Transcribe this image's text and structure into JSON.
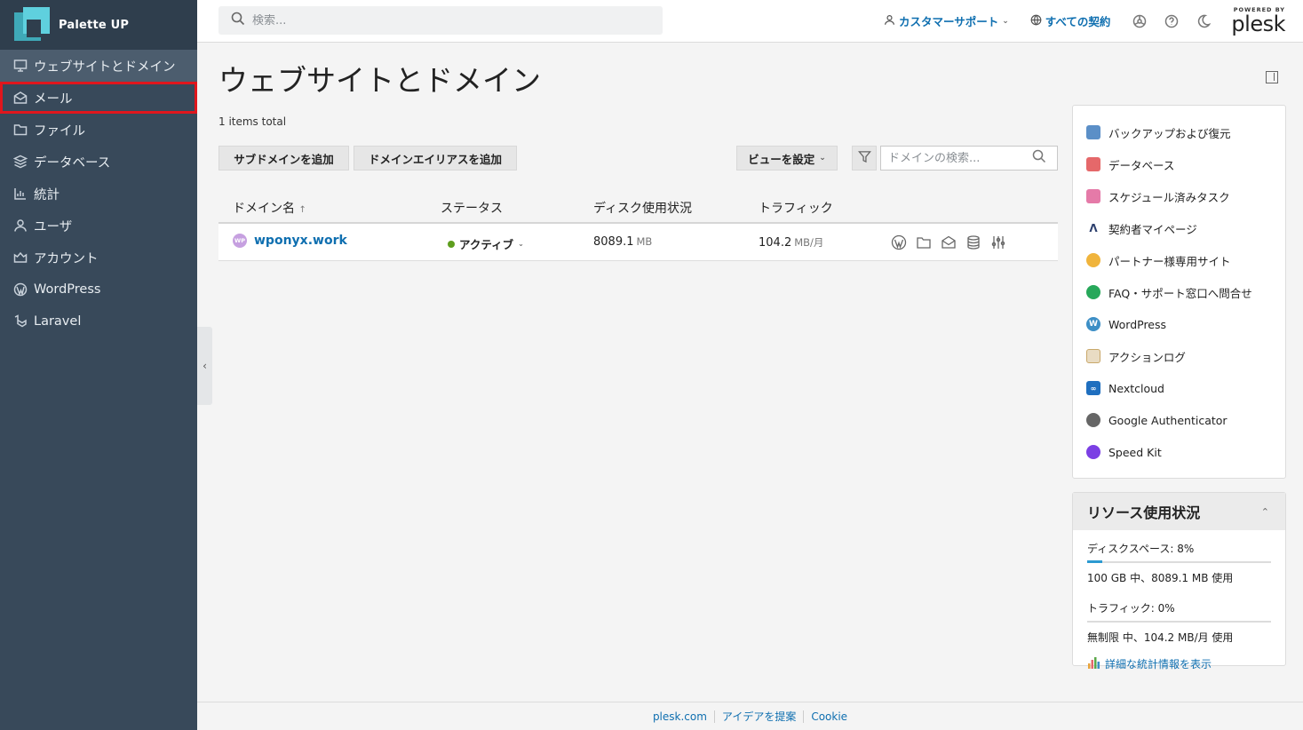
{
  "brand": {
    "name": "Palette UP"
  },
  "sidebar": {
    "items": [
      {
        "label": "ウェブサイトとドメイン",
        "icon": "monitor-icon",
        "active": true
      },
      {
        "label": "メール",
        "icon": "mail-icon",
        "highlighted": true
      },
      {
        "label": "ファイル",
        "icon": "folder-icon"
      },
      {
        "label": "データベース",
        "icon": "database-icon"
      },
      {
        "label": "統計",
        "icon": "statistics-icon"
      },
      {
        "label": "ユーザ",
        "icon": "user-icon"
      },
      {
        "label": "アカウント",
        "icon": "account-icon"
      },
      {
        "label": "WordPress",
        "icon": "wordpress-icon"
      },
      {
        "label": "Laravel",
        "icon": "laravel-icon"
      }
    ],
    "collapse_label": "‹"
  },
  "topbar": {
    "search_placeholder": "検索...",
    "customer_support": "カスタマーサポート",
    "all_subscriptions": "すべての契約",
    "powered_by": "POWERED BY",
    "plesk": "plesk"
  },
  "main": {
    "title": "ウェブサイトとドメイン",
    "items_total": "1 items total",
    "buttons": {
      "add_subdomain": "サブドメインを追加",
      "add_alias": "ドメインエイリアスを追加",
      "set_view": "ビューを設定"
    },
    "domain_search_placeholder": "ドメインの検索...",
    "columns": {
      "domain": "ドメイン名",
      "sort_indicator": "↑",
      "status": "ステータス",
      "disk": "ディスク使用状況",
      "traffic": "トラフィック"
    },
    "rows": [
      {
        "badge": "WP",
        "domain": "wponyx.work",
        "status": "アクティブ",
        "disk_value": "8089.1",
        "disk_unit": "MB",
        "traffic_value": "104.2",
        "traffic_unit": "MB/月"
      }
    ]
  },
  "right_panel": {
    "links": [
      {
        "label": "バックアップおよび復元",
        "icon": "backup-icon",
        "color": "#5b8fc7"
      },
      {
        "label": "データベース",
        "icon": "database-icon",
        "color": "#e5686a"
      },
      {
        "label": "スケジュール済みタスク",
        "icon": "calendar-icon",
        "color": "#e57aa8"
      },
      {
        "label": "契約者マイページ",
        "icon": "mypage-icon",
        "color": "#2b3e6c"
      },
      {
        "label": "パートナー様専用サイト",
        "icon": "partner-icon",
        "color": "#f0b43c"
      },
      {
        "label": "FAQ・サポート窓口へ問合せ",
        "icon": "support-icon",
        "color": "#27a85a"
      },
      {
        "label": "WordPress",
        "icon": "wordpress-icon",
        "color": "#3d8fc6"
      },
      {
        "label": "アクションログ",
        "icon": "log-icon",
        "color": "#c9a86a"
      },
      {
        "label": "Nextcloud",
        "icon": "nextcloud-icon",
        "color": "#1f6fbf"
      },
      {
        "label": "Google Authenticator",
        "icon": "authenticator-icon",
        "color": "#666666"
      },
      {
        "label": "Speed Kit",
        "icon": "speedkit-icon",
        "color": "#7b3fe4"
      }
    ],
    "resources": {
      "title": "リソース使用状況",
      "disk_label": "ディスクスペース: 8%",
      "disk_percent": 8,
      "disk_detail": "100 GB 中、8089.1 MB 使用",
      "traffic_label": "トラフィック: 0%",
      "traffic_percent": 0,
      "traffic_detail": "無制限 中、104.2 MB/月 使用",
      "stats_link": "詳細な統計情報を表示"
    }
  },
  "footer": {
    "links": [
      "plesk.com",
      "アイデアを提案",
      "Cookie"
    ]
  }
}
